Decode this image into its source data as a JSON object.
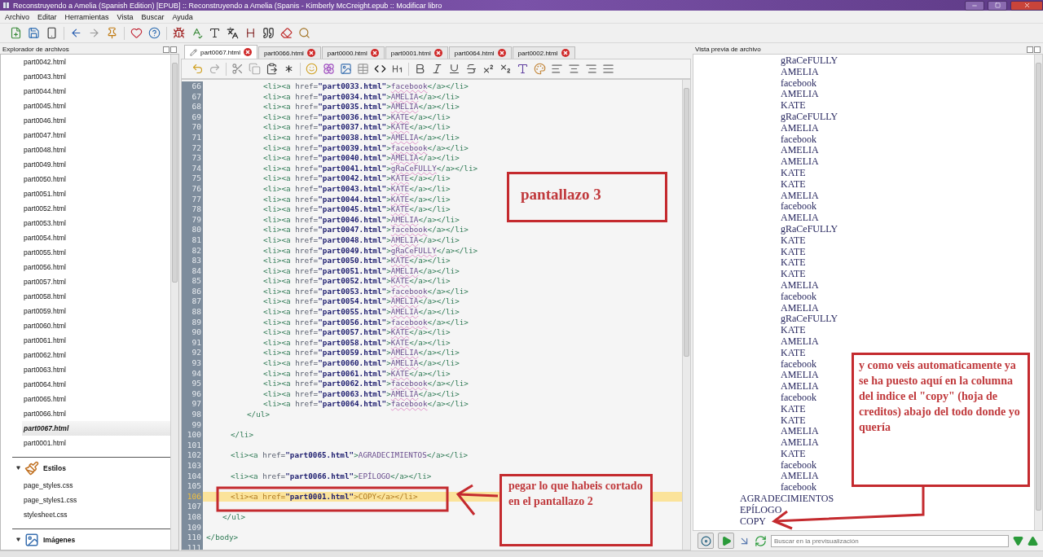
{
  "window": {
    "title": "Reconstruyendo a Amelia (Spanish Edition) [EPUB] :: Reconstruyendo a Amelia (Spanis - Kimberly McCreight.epub :: Modificar libro"
  },
  "menu": [
    "Archivo",
    "Editar",
    "Herramientas",
    "Vista",
    "Buscar",
    "Ayuda"
  ],
  "file_browser": {
    "title": "Explorador de archivos",
    "text_files": [
      {
        "name": "part0042.html",
        "selected": false
      },
      {
        "name": "part0043.html",
        "selected": false
      },
      {
        "name": "part0044.html",
        "selected": false
      },
      {
        "name": "part0045.html",
        "selected": false
      },
      {
        "name": "part0046.html",
        "selected": false
      },
      {
        "name": "part0047.html",
        "selected": false
      },
      {
        "name": "part0048.html",
        "selected": false
      },
      {
        "name": "part0049.html",
        "selected": false
      },
      {
        "name": "part0050.html",
        "selected": false
      },
      {
        "name": "part0051.html",
        "selected": false
      },
      {
        "name": "part0052.html",
        "selected": false
      },
      {
        "name": "part0053.html",
        "selected": false
      },
      {
        "name": "part0054.html",
        "selected": false
      },
      {
        "name": "part0055.html",
        "selected": false
      },
      {
        "name": "part0056.html",
        "selected": false
      },
      {
        "name": "part0057.html",
        "selected": false
      },
      {
        "name": "part0058.html",
        "selected": false
      },
      {
        "name": "part0059.html",
        "selected": false
      },
      {
        "name": "part0060.html",
        "selected": false
      },
      {
        "name": "part0061.html",
        "selected": false
      },
      {
        "name": "part0062.html",
        "selected": false
      },
      {
        "name": "part0063.html",
        "selected": false
      },
      {
        "name": "part0064.html",
        "selected": false
      },
      {
        "name": "part0065.html",
        "selected": false
      },
      {
        "name": "part0066.html",
        "selected": false
      },
      {
        "name": "part0067.html",
        "selected": true
      },
      {
        "name": "part0001.html",
        "selected": false
      }
    ],
    "sections": [
      {
        "label": "Estilos",
        "kind": "styles",
        "expanded": true,
        "children": [
          {
            "name": "page_styles.css",
            "selected": false
          },
          {
            "name": "page_styles1.css",
            "selected": false
          },
          {
            "name": "stylesheet.css",
            "selected": false
          }
        ]
      },
      {
        "label": "Imágenes",
        "kind": "images",
        "expanded": true
      }
    ]
  },
  "editor": {
    "tabs": [
      {
        "label": "part0067.html",
        "selected": true
      },
      {
        "label": "part0066.html",
        "selected": false
      },
      {
        "label": "part0000.html",
        "selected": false
      },
      {
        "label": "part0001.html",
        "selected": false
      },
      {
        "label": "part0064.html",
        "selected": false
      },
      {
        "label": "part0002.html",
        "selected": false
      }
    ],
    "lines": [
      {
        "number": "66",
        "kind": "nested",
        "code": "<li><a href=\"part0033.html\">facebook</a></li>",
        "current": false
      },
      {
        "number": "67",
        "kind": "nested",
        "code": "<li><a href=\"part0034.html\">AMELIA</a></li>",
        "current": false
      },
      {
        "number": "68",
        "kind": "nested",
        "code": "<li><a href=\"part0035.html\">AMELIA</a></li>",
        "current": false
      },
      {
        "number": "69",
        "kind": "nested",
        "code": "<li><a href=\"part0036.html\">KATE</a></li>",
        "current": false
      },
      {
        "number": "70",
        "kind": "nested",
        "code": "<li><a href=\"part0037.html\">KATE</a></li>",
        "current": false
      },
      {
        "number": "71",
        "kind": "nested",
        "code": "<li><a href=\"part0038.html\">AMELIA</a></li>",
        "current": false
      },
      {
        "number": "72",
        "kind": "nested",
        "code": "<li><a href=\"part0039.html\">facebook</a></li>",
        "current": false
      },
      {
        "number": "73",
        "kind": "nested",
        "code": "<li><a href=\"part0040.html\">AMELIA</a></li>",
        "current": false
      },
      {
        "number": "74",
        "kind": "nested",
        "code": "<li><a href=\"part0041.html\">gRaCeFULLY</a></li>",
        "current": false
      },
      {
        "number": "75",
        "kind": "nested",
        "code": "<li><a href=\"part0042.html\">KATE</a></li>",
        "current": false
      },
      {
        "number": "76",
        "kind": "nested",
        "code": "<li><a href=\"part0043.html\">KATE</a></li>",
        "current": false
      },
      {
        "number": "77",
        "kind": "nested",
        "code": "<li><a href=\"part0044.html\">KATE</a></li>",
        "current": false
      },
      {
        "number": "78",
        "kind": "nested",
        "code": "<li><a href=\"part0045.html\">KATE</a></li>",
        "current": false
      },
      {
        "number": "79",
        "kind": "nested",
        "code": "<li><a href=\"part0046.html\">AMELIA</a></li>",
        "current": false
      },
      {
        "number": "80",
        "kind": "nested",
        "code": "<li><a href=\"part0047.html\">facebook</a></li>",
        "current": false
      },
      {
        "number": "81",
        "kind": "nested",
        "code": "<li><a href=\"part0048.html\">AMELIA</a></li>",
        "current": false
      },
      {
        "number": "82",
        "kind": "nested",
        "code": "<li><a href=\"part0049.html\">gRaCeFULLY</a></li>",
        "current": false
      },
      {
        "number": "83",
        "kind": "nested",
        "code": "<li><a href=\"part0050.html\">KATE</a></li>",
        "current": false
      },
      {
        "number": "84",
        "kind": "nested",
        "code": "<li><a href=\"part0051.html\">AMELIA</a></li>",
        "current": false
      },
      {
        "number": "85",
        "kind": "nested",
        "code": "<li><a href=\"part0052.html\">KATE</a></li>",
        "current": false
      },
      {
        "number": "86",
        "kind": "nested",
        "code": "<li><a href=\"part0053.html\">facebook</a></li>",
        "current": false
      },
      {
        "number": "87",
        "kind": "nested",
        "code": "<li><a href=\"part0054.html\">AMELIA</a></li>",
        "current": false
      },
      {
        "number": "88",
        "kind": "nested",
        "code": "<li><a href=\"part0055.html\">AMELIA</a></li>",
        "current": false
      },
      {
        "number": "89",
        "kind": "nested",
        "code": "<li><a href=\"part0056.html\">facebook</a></li>",
        "current": false
      },
      {
        "number": "90",
        "kind": "nested",
        "code": "<li><a href=\"part0057.html\">KATE</a></li>",
        "current": false
      },
      {
        "number": "91",
        "kind": "nested",
        "code": "<li><a href=\"part0058.html\">KATE</a></li>",
        "current": false
      },
      {
        "number": "92",
        "kind": "nested",
        "code": "<li><a href=\"part0059.html\">AMELIA</a></li>",
        "current": false
      },
      {
        "number": "93",
        "kind": "nested",
        "code": "<li><a href=\"part0060.html\">AMELIA</a></li>",
        "current": false
      },
      {
        "number": "94",
        "kind": "nested",
        "code": "<li><a href=\"part0061.html\">KATE</a></li>",
        "current": false
      },
      {
        "number": "95",
        "kind": "nested",
        "code": "<li><a href=\"part0062.html\">facebook</a></li>",
        "current": false
      },
      {
        "number": "96",
        "kind": "nested",
        "code": "<li><a href=\"part0063.html\">AMELIA</a></li>",
        "current": false
      },
      {
        "number": "97",
        "kind": "nested",
        "code": "<li><a href=\"part0064.html\">facebook</a></li>",
        "current": false
      },
      {
        "number": "98",
        "kind": "inner",
        "code": "</ul>",
        "current": false
      },
      {
        "number": "99",
        "current": false
      },
      {
        "number": "100",
        "kind": "item",
        "code": "</li>",
        "current": false
      },
      {
        "number": "101",
        "current": false
      },
      {
        "number": "102",
        "kind": "item",
        "code": "<li><a href=\"part0065.html\">AGRADECIMIENTOS</a></li>",
        "current": false
      },
      {
        "number": "103",
        "current": false
      },
      {
        "number": "104",
        "kind": "item",
        "code": "<li><a href=\"part0066.html\">EPÍLOGO</a></li>",
        "current": false
      },
      {
        "number": "105",
        "current": false
      },
      {
        "number": "106",
        "kind": "item",
        "code": "<li><a href=\"part0001.html\">COPY</a></li>",
        "current": true
      },
      {
        "number": "107",
        "current": false
      },
      {
        "number": "108",
        "kind": "list",
        "code": "</ul>",
        "current": false
      },
      {
        "number": "109",
        "current": false
      },
      {
        "number": "110",
        "kind": "root",
        "code": "</body>",
        "current": false
      },
      {
        "number": "111",
        "current": false
      }
    ]
  },
  "preview": {
    "title": "Vista previa de archivo",
    "entries": [
      {
        "text": "gRaCeFULLY",
        "kind": "nested"
      },
      {
        "text": "AMELIA",
        "kind": "nested"
      },
      {
        "text": "facebook",
        "kind": "nested"
      },
      {
        "text": "AMELIA",
        "kind": "nested"
      },
      {
        "text": "KATE",
        "kind": "nested"
      },
      {
        "text": "gRaCeFULLY",
        "kind": "nested"
      },
      {
        "text": "AMELIA",
        "kind": "nested"
      },
      {
        "text": "facebook",
        "kind": "nested"
      },
      {
        "text": "AMELIA",
        "kind": "nested"
      },
      {
        "text": "AMELIA",
        "kind": "nested"
      },
      {
        "text": "KATE",
        "kind": "nested"
      },
      {
        "text": "KATE",
        "kind": "nested"
      },
      {
        "text": "AMELIA",
        "kind": "nested"
      },
      {
        "text": "facebook",
        "kind": "nested"
      },
      {
        "text": "AMELIA",
        "kind": "nested"
      },
      {
        "text": "gRaCeFULLY",
        "kind": "nested"
      },
      {
        "text": "KATE",
        "kind": "nested"
      },
      {
        "text": "KATE",
        "kind": "nested"
      },
      {
        "text": "KATE",
        "kind": "nested"
      },
      {
        "text": "KATE",
        "kind": "nested"
      },
      {
        "text": "AMELIA",
        "kind": "nested"
      },
      {
        "text": "facebook",
        "kind": "nested"
      },
      {
        "text": "AMELIA",
        "kind": "nested"
      },
      {
        "text": "gRaCeFULLY",
        "kind": "nested"
      },
      {
        "text": "KATE",
        "kind": "nested"
      },
      {
        "text": "AMELIA",
        "kind": "nested"
      },
      {
        "text": "KATE",
        "kind": "nested"
      },
      {
        "text": "facebook",
        "kind": "nested"
      },
      {
        "text": "AMELIA",
        "kind": "nested"
      },
      {
        "text": "AMELIA",
        "kind": "nested"
      },
      {
        "text": "facebook",
        "kind": "nested"
      },
      {
        "text": "KATE",
        "kind": "nested"
      },
      {
        "text": "KATE",
        "kind": "nested"
      },
      {
        "text": "AMELIA",
        "kind": "nested"
      },
      {
        "text": "AMELIA",
        "kind": "nested"
      },
      {
        "text": "KATE",
        "kind": "nested"
      },
      {
        "text": "facebook",
        "kind": "nested"
      },
      {
        "text": "AMELIA",
        "kind": "nested"
      },
      {
        "text": "facebook",
        "kind": "nested"
      },
      {
        "text": "AGRADECIMIENTOS",
        "kind": "top"
      },
      {
        "text": "EPÍLOGO",
        "kind": "top"
      },
      {
        "text": "COPY",
        "kind": "top"
      }
    ],
    "search": {
      "placeholder": "Buscar en la previsualización"
    }
  },
  "annotations": [
    {
      "kind": "title",
      "text": "pantallazo 3"
    },
    {
      "kind": "left_note",
      "text": "pegar lo que habeis cortado en el pantallazo 2"
    },
    {
      "kind": "right_note",
      "text": "y como veis automaticamente ya se ha puesto aquí en la columna del indice el \"copy\" (hoja de creditos) abajo del todo donde yo quería"
    }
  ]
}
